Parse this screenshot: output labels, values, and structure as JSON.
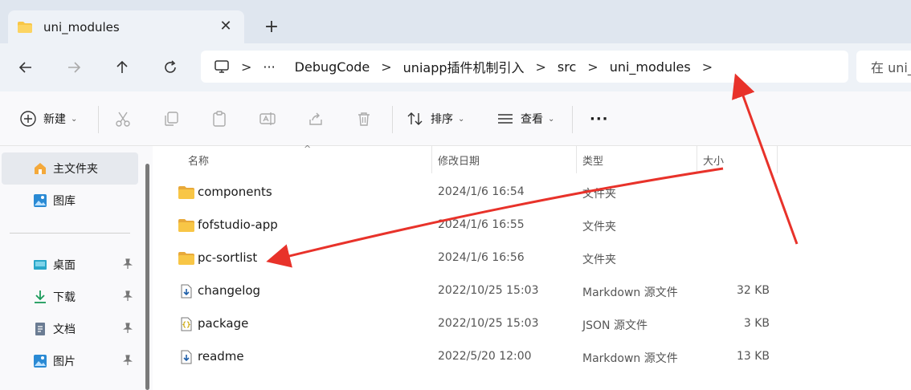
{
  "tab": {
    "title": "uni_modules",
    "close_glyph": "✕",
    "new_tab_glyph": "+"
  },
  "nav": {
    "breadcrumb": [
      "DebugCode",
      "uniapp插件机制引入",
      "src",
      "uni_modules"
    ],
    "more_glyph": "···",
    "sep_glyph": ">",
    "search_placeholder": "在 uni_modules 中搜索"
  },
  "toolbar": {
    "new_label": "新建",
    "sort_label": "排序",
    "view_label": "查看",
    "more_glyph": "···",
    "chevron": "⌄"
  },
  "sidebar": {
    "items": [
      {
        "label": "主文件夹",
        "icon": "home-icon",
        "active": true
      },
      {
        "label": "图库",
        "icon": "gallery-icon"
      },
      {
        "label": "桌面",
        "icon": "desktop-icon",
        "pinned": true
      },
      {
        "label": "下载",
        "icon": "download-icon",
        "pinned": true
      },
      {
        "label": "文档",
        "icon": "document-icon",
        "pinned": true
      },
      {
        "label": "图片",
        "icon": "pictures-icon",
        "pinned": true
      }
    ]
  },
  "columns": {
    "name": "名称",
    "modified": "修改日期",
    "type": "类型",
    "size": "大小",
    "sort_glyph": "^"
  },
  "files": [
    {
      "name": "components",
      "modified": "2024/1/6 16:54",
      "type": "文件夹",
      "size": "",
      "icon": "folder-icon"
    },
    {
      "name": "fofstudio-app",
      "modified": "2024/1/6 16:55",
      "type": "文件夹",
      "size": "",
      "icon": "folder-icon"
    },
    {
      "name": "pc-sortlist",
      "modified": "2024/1/6 16:56",
      "type": "文件夹",
      "size": "",
      "icon": "folder-icon"
    },
    {
      "name": "changelog",
      "modified": "2022/10/25 15:03",
      "type": "Markdown 源文件",
      "size": "32 KB",
      "icon": "markdown-file-icon"
    },
    {
      "name": "package",
      "modified": "2022/10/25 15:03",
      "type": "JSON 源文件",
      "size": "3 KB",
      "icon": "json-file-icon"
    },
    {
      "name": "readme",
      "modified": "2022/5/20 12:00",
      "type": "Markdown 源文件",
      "size": "13 KB",
      "icon": "markdown-file-icon"
    }
  ],
  "colors": {
    "accent": "#0067c0",
    "folder": "#f8c646",
    "annotation": "#e8322a"
  }
}
